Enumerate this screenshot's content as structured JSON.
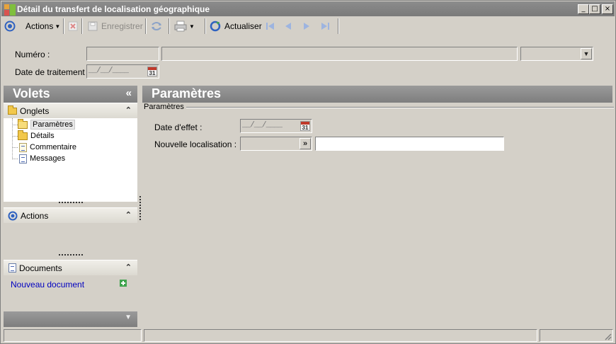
{
  "window": {
    "title": "Détail du transfert de localisation géographique",
    "controls": {
      "minimize": "_",
      "maximize": "□",
      "close": "×"
    }
  },
  "toolbar": {
    "actions_label": "Actions",
    "save_label": "Enregistrer",
    "refresh_label": "Actualiser"
  },
  "header": {
    "numero_label": "Numéro :",
    "numero_value": "",
    "description_value": "",
    "status_value": "",
    "date_label": "Date de traitement :",
    "date_value": "__/__/____",
    "calendar_day": "31"
  },
  "left_panel": {
    "title": "Volets",
    "collapse_glyph": "«",
    "onglets": {
      "title": "Onglets",
      "items": [
        {
          "label": "Paramètres",
          "icon": "folder-open-icon"
        },
        {
          "label": "Détails",
          "icon": "folder-icon"
        },
        {
          "label": "Commentaire",
          "icon": "note-icon"
        },
        {
          "label": "Messages",
          "icon": "document-icon"
        }
      ]
    },
    "actions": {
      "title": "Actions"
    },
    "documents": {
      "title": "Documents",
      "new_document": "Nouveau document"
    },
    "expand_glyph": "⌄",
    "collapse_section_glyph": "⌃"
  },
  "main": {
    "title": "Paramètres",
    "group_label": "Paramètres",
    "date_effet_label": "Date d'effet :",
    "date_effet_value": "__/__/____",
    "calendar_day": "31",
    "nouvelle_localisation_label": "Nouvelle localisation :",
    "nouvelle_localisation_code": "",
    "nouvelle_localisation_desc": ""
  },
  "colors": {
    "panel_header": "#8a8a8a",
    "link": "#0000c0",
    "window_bg": "#d4d0c8"
  }
}
